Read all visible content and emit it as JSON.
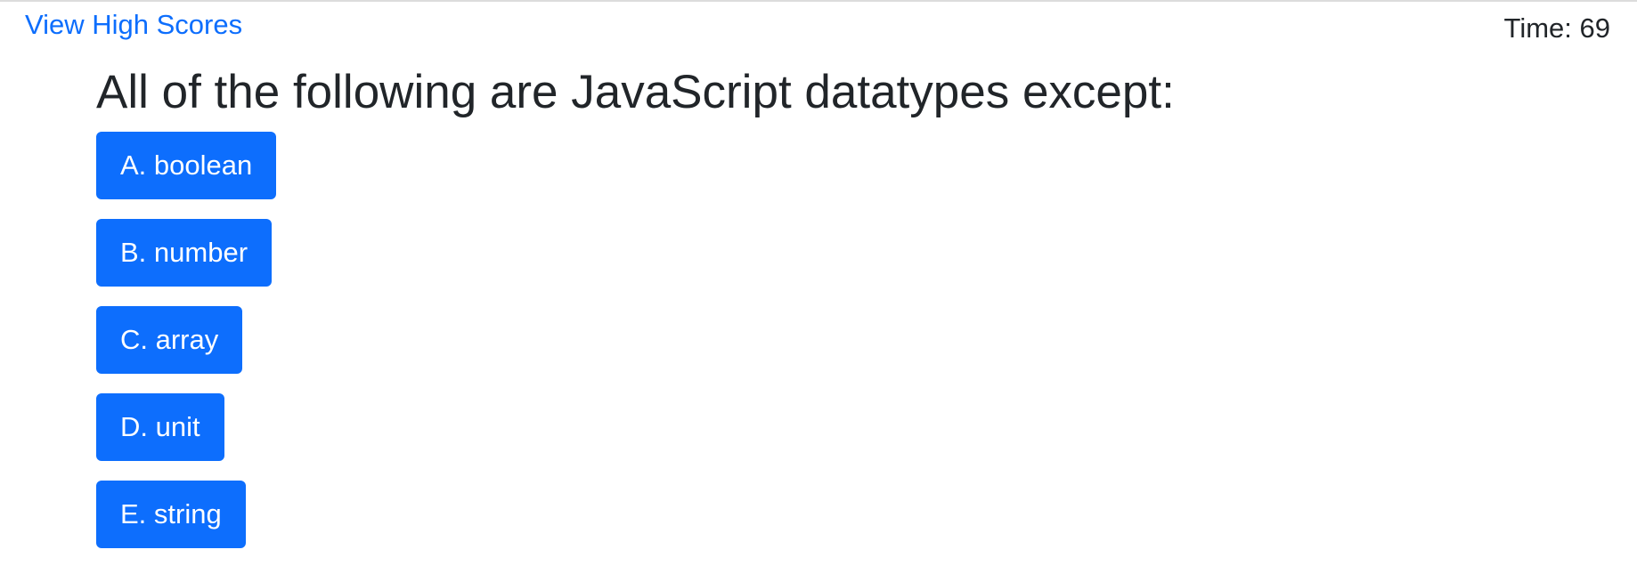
{
  "header": {
    "high_scores_link": "View High Scores",
    "timer_text": "Time: 69"
  },
  "quiz": {
    "question": "All of the following are JavaScript datatypes except:",
    "choices": [
      {
        "label": "A. boolean"
      },
      {
        "label": "B. number"
      },
      {
        "label": "C. array"
      },
      {
        "label": "D. unit"
      },
      {
        "label": "E. string"
      }
    ]
  },
  "colors": {
    "accent": "#0d6efd",
    "text": "#212529",
    "background": "#ffffff"
  }
}
